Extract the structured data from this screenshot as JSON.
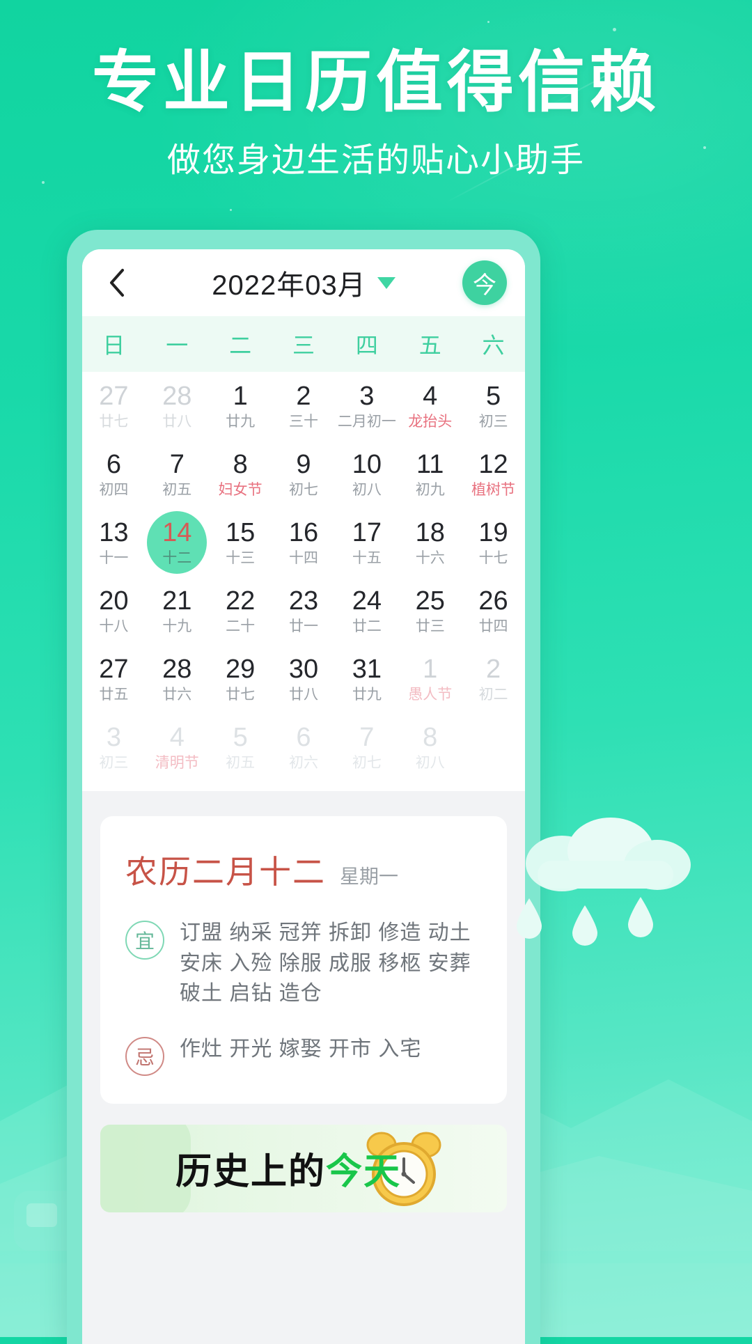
{
  "promo": {
    "headline": "专业日历值得信赖",
    "subhead": "做您身边生活的贴心小助手",
    "accent_green": "#14d6a4",
    "headline_color": "#ffffff"
  },
  "app": {
    "navbar": {
      "back_icon": "chevron-left-icon",
      "title": "2022年03月",
      "dropdown_icon": "caret-down-icon",
      "today_button": "今"
    },
    "weekdays": [
      "日",
      "一",
      "二",
      "三",
      "四",
      "五",
      "六"
    ],
    "selected_day": 14,
    "days": [
      {
        "d": "27",
        "l": "廿七",
        "out": true,
        "fest": false,
        "fade": false
      },
      {
        "d": "28",
        "l": "廿八",
        "out": true,
        "fest": false,
        "fade": false
      },
      {
        "d": "1",
        "l": "廿九",
        "out": false,
        "fest": false,
        "fade": false
      },
      {
        "d": "2",
        "l": "三十",
        "out": false,
        "fest": false,
        "fade": false
      },
      {
        "d": "3",
        "l": "二月初一",
        "out": false,
        "fest": false,
        "fade": false
      },
      {
        "d": "4",
        "l": "龙抬头",
        "out": false,
        "fest": true,
        "fade": false
      },
      {
        "d": "5",
        "l": "初三",
        "out": false,
        "fest": false,
        "fade": false
      },
      {
        "d": "6",
        "l": "初四",
        "out": false,
        "fest": false,
        "fade": false
      },
      {
        "d": "7",
        "l": "初五",
        "out": false,
        "fest": false,
        "fade": false
      },
      {
        "d": "8",
        "l": "妇女节",
        "out": false,
        "fest": true,
        "fade": false
      },
      {
        "d": "9",
        "l": "初七",
        "out": false,
        "fest": false,
        "fade": false
      },
      {
        "d": "10",
        "l": "初八",
        "out": false,
        "fest": false,
        "fade": false
      },
      {
        "d": "11",
        "l": "初九",
        "out": false,
        "fest": false,
        "fade": false
      },
      {
        "d": "12",
        "l": "植树节",
        "out": false,
        "fest": true,
        "fade": false
      },
      {
        "d": "13",
        "l": "十一",
        "out": false,
        "fest": false,
        "fade": false
      },
      {
        "d": "14",
        "l": "十二",
        "out": false,
        "fest": false,
        "fade": false,
        "selected": true
      },
      {
        "d": "15",
        "l": "十三",
        "out": false,
        "fest": false,
        "fade": false
      },
      {
        "d": "16",
        "l": "十四",
        "out": false,
        "fest": false,
        "fade": false
      },
      {
        "d": "17",
        "l": "十五",
        "out": false,
        "fest": false,
        "fade": false
      },
      {
        "d": "18",
        "l": "十六",
        "out": false,
        "fest": false,
        "fade": false
      },
      {
        "d": "19",
        "l": "十七",
        "out": false,
        "fest": false,
        "fade": false
      },
      {
        "d": "20",
        "l": "十八",
        "out": false,
        "fest": false,
        "fade": false
      },
      {
        "d": "21",
        "l": "十九",
        "out": false,
        "fest": false,
        "fade": false
      },
      {
        "d": "22",
        "l": "二十",
        "out": false,
        "fest": false,
        "fade": false
      },
      {
        "d": "23",
        "l": "廿一",
        "out": false,
        "fest": false,
        "fade": false
      },
      {
        "d": "24",
        "l": "廿二",
        "out": false,
        "fest": false,
        "fade": false
      },
      {
        "d": "25",
        "l": "廿三",
        "out": false,
        "fest": false,
        "fade": false
      },
      {
        "d": "26",
        "l": "廿四",
        "out": false,
        "fest": false,
        "fade": false
      },
      {
        "d": "27",
        "l": "廿五",
        "out": false,
        "fest": false,
        "fade": false
      },
      {
        "d": "28",
        "l": "廿六",
        "out": false,
        "fest": false,
        "fade": false
      },
      {
        "d": "29",
        "l": "廿七",
        "out": false,
        "fest": false,
        "fade": false
      },
      {
        "d": "30",
        "l": "廿八",
        "out": false,
        "fest": false,
        "fade": false
      },
      {
        "d": "31",
        "l": "廿九",
        "out": false,
        "fest": false,
        "fade": false
      },
      {
        "d": "1",
        "l": "愚人节",
        "out": true,
        "fest": true,
        "fade": false
      },
      {
        "d": "2",
        "l": "初二",
        "out": true,
        "fest": false,
        "fade": false
      },
      {
        "d": "3",
        "l": "初三",
        "out": true,
        "fest": false,
        "fade": true
      },
      {
        "d": "4",
        "l": "清明节",
        "out": true,
        "fest": true,
        "fade": true
      },
      {
        "d": "5",
        "l": "初五",
        "out": true,
        "fest": false,
        "fade": true
      },
      {
        "d": "6",
        "l": "初六",
        "out": true,
        "fest": false,
        "fade": true
      },
      {
        "d": "7",
        "l": "初七",
        "out": true,
        "fest": false,
        "fade": true
      },
      {
        "d": "8",
        "l": "初八",
        "out": true,
        "fest": false,
        "fade": true
      },
      {
        "d": "",
        "l": "",
        "out": true,
        "fest": false,
        "fade": true
      }
    ],
    "detail": {
      "lunar_date": "农历二月十二",
      "weekday": "星期一",
      "yi_badge": "宜",
      "yi_text": "订盟 纳采 冠笄 拆卸 修造 动土 安床 入殓 除服 成服 移柩 安葬 破土 启钻 造仓",
      "ji_badge": "忌",
      "ji_text": "作灶 开光 嫁娶 开市 入宅"
    },
    "history_banner": {
      "title_plain": "历史上的",
      "title_accent": "今天",
      "clock_icon": "alarm-clock-icon"
    }
  }
}
